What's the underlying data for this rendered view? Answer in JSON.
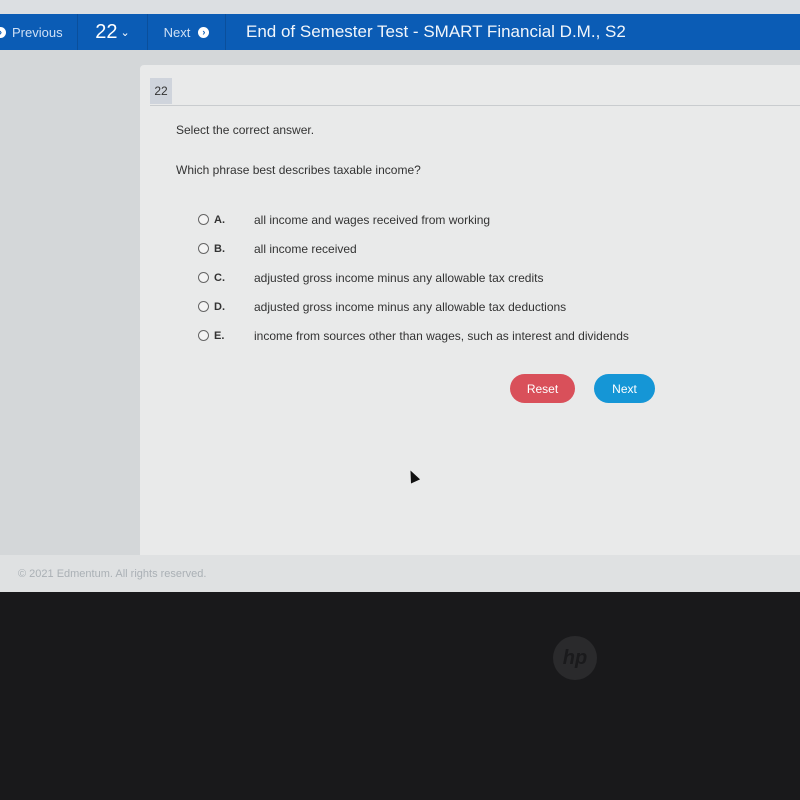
{
  "navbar": {
    "previous_label": "Previous",
    "question_number": "22",
    "next_label": "Next",
    "title": "End of Semester Test - SMART Financial D.M., S2",
    "color": "#0b5cb5"
  },
  "question": {
    "number": "22",
    "instruction": "Select the correct answer.",
    "text": "Which phrase best describes taxable income?",
    "options": [
      {
        "letter": "A.",
        "text": "all income and wages received from working"
      },
      {
        "letter": "B.",
        "text": "all income received"
      },
      {
        "letter": "C.",
        "text": "adjusted gross income minus any allowable tax credits"
      },
      {
        "letter": "D.",
        "text": "adjusted gross income minus any allowable tax deductions"
      },
      {
        "letter": "E.",
        "text": "income from sources other than wages, such as interest and dividends"
      }
    ],
    "reset_label": "Reset",
    "next_label": "Next"
  },
  "footer": {
    "copyright": "© 2021 Edmentum. All rights reserved."
  },
  "bezel": {
    "logo": "hp"
  }
}
